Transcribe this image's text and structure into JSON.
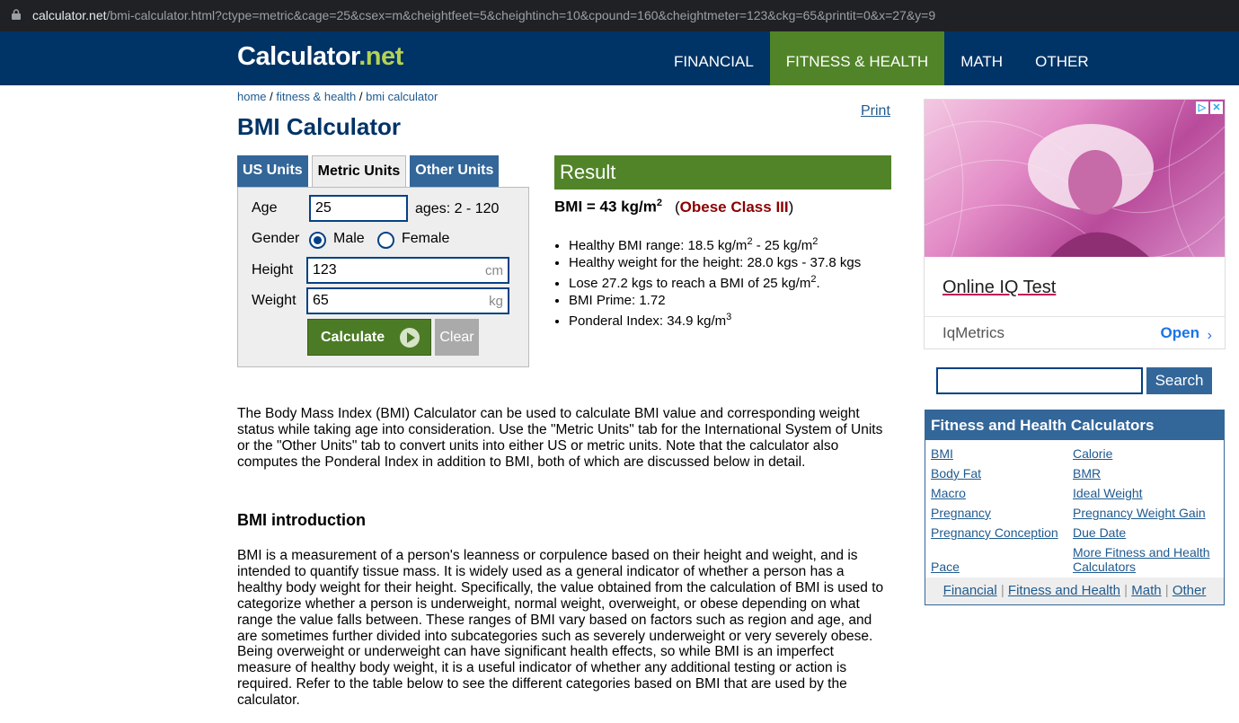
{
  "browser": {
    "url_domain": "calculator.net",
    "url_path": "/bmi-calculator.html?ctype=metric&cage=25&csex=m&cheightfeet=5&cheightinch=10&cpound=160&cheightmeter=123&ckg=65&printit=0&x=27&y=9"
  },
  "header": {
    "logo_main": "Calculator",
    "logo_dot_net": ".net",
    "nav": [
      "FINANCIAL",
      "FITNESS & HEALTH",
      "MATH",
      "OTHER"
    ],
    "active_nav": "FITNESS & HEALTH"
  },
  "breadcrumb": {
    "home": "home",
    "sep": " / ",
    "fitness": "fitness & health",
    "current": "bmi calculator"
  },
  "page_title": "BMI Calculator",
  "print_link": "Print",
  "tabs": [
    "US Units",
    "Metric Units",
    "Other Units"
  ],
  "form": {
    "age_label": "Age",
    "age_value": "25",
    "age_range": "ages: 2 - 120",
    "gender_label": "Gender",
    "male_label": "Male",
    "female_label": "Female",
    "height_label": "Height",
    "height_value": "123",
    "height_unit": "cm",
    "weight_label": "Weight",
    "weight_value": "65",
    "weight_unit": "kg",
    "calculate": "Calculate",
    "clear": "Clear"
  },
  "result": {
    "heading": "Result",
    "bmi_text": "BMI = 43 kg/m",
    "bmi_sup": "2",
    "class_open": "(",
    "class": "Obese Class III",
    "class_close": ")",
    "items": [
      {
        "a": "Healthy BMI range: 18.5 kg/m",
        "s1": "2",
        "b": " - 25 kg/m",
        "s2": "2",
        "c": ""
      },
      {
        "a": "Healthy weight for the height: 28.0 kgs - 37.8 kgs",
        "s1": "",
        "b": "",
        "s2": "",
        "c": ""
      },
      {
        "a": "Lose 27.2 kgs to reach a BMI of 25 kg/m",
        "s1": "2",
        "b": ".",
        "s2": "",
        "c": ""
      },
      {
        "a": "BMI Prime: 1.72",
        "s1": "",
        "b": "",
        "s2": "",
        "c": ""
      },
      {
        "a": "Ponderal Index: 34.9 kg/m",
        "s1": "3",
        "b": "",
        "s2": "",
        "c": ""
      }
    ]
  },
  "intro_paragraph": "The Body Mass Index (BMI) Calculator can be used to calculate BMI value and corresponding weight status while taking age into consideration. Use the \"Metric Units\" tab for the International System of Units or the \"Other Units\" tab to convert units into either US or metric units. Note that the calculator also computes the Ponderal Index in addition to BMI, both of which are discussed below in detail.",
  "section_heading": "BMI introduction",
  "section_paragraph": "BMI is a measurement of a person's leanness or corpulence based on their height and weight, and is intended to quantify tissue mass. It is widely used as a general indicator of whether a person has a healthy body weight for their height. Specifically, the value obtained from the calculation of BMI is used to categorize whether a person is underweight, normal weight, overweight, or obese depending on what range the value falls between. These ranges of BMI vary based on factors such as region and age, and are sometimes further divided into subcategories such as severely underweight or very severely obese. Being overweight or underweight can have significant health effects, so while BMI is an imperfect measure of healthy body weight, it is a useful indicator of whether any additional testing or action is required. Refer to the table below to see the different categories based on BMI that are used by the calculator.",
  "ad": {
    "headline": "Online IQ Test",
    "brand": "IqMetrics",
    "cta": "Open"
  },
  "search": {
    "button": "Search",
    "value": ""
  },
  "sidebar": {
    "heading": "Fitness and Health Calculators",
    "left_links": [
      "BMI",
      "Body Fat",
      "Macro",
      "Pregnancy",
      "Pregnancy Conception",
      "Pace"
    ],
    "right_links": [
      "Calorie",
      "BMR",
      "Ideal Weight",
      "Pregnancy Weight Gain",
      "Due Date",
      "More Fitness and Health Calculators"
    ],
    "footer_links": [
      "Financial",
      "Fitness and Health",
      "Math",
      "Other"
    ]
  },
  "colors": {
    "header_bg": "#003366",
    "active_nav_bg": "#518428",
    "logo_net": "#b4d353",
    "obese_class": "#8b0000"
  }
}
